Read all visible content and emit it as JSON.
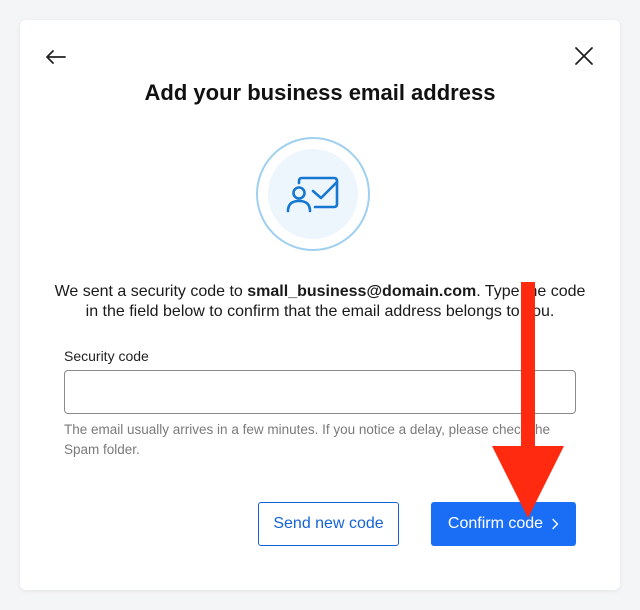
{
  "dialog": {
    "title": "Add your business email address",
    "message_before": "We sent a security code to ",
    "email": "small_business@domain.com",
    "message_after": ". Type the code in the field below to confirm that the email address belongs to you.",
    "field_label": "Security code",
    "field_value": "",
    "field_placeholder": "",
    "helper_text": "The email usually arrives in a few minutes.  If you notice a delay, please check the Spam folder.",
    "send_new_code_label": "Send new code",
    "confirm_code_label": "Confirm code"
  },
  "icons": {
    "back": "arrow-left-icon",
    "close": "close-icon",
    "illustration": "email-contact-card-icon",
    "confirm_chevron": "chevron-right-icon",
    "annotation": "red-arrow-down-annotation"
  },
  "colors": {
    "primary": "#1a6ef5",
    "primary_text_outline": "#1463d6",
    "icon_blue": "#1677d2",
    "circle_light": "#eef6fd",
    "circle_ring": "#9fd0ef",
    "annotation_red": "#ff2a0f",
    "helper_gray": "#7a7a7a"
  }
}
